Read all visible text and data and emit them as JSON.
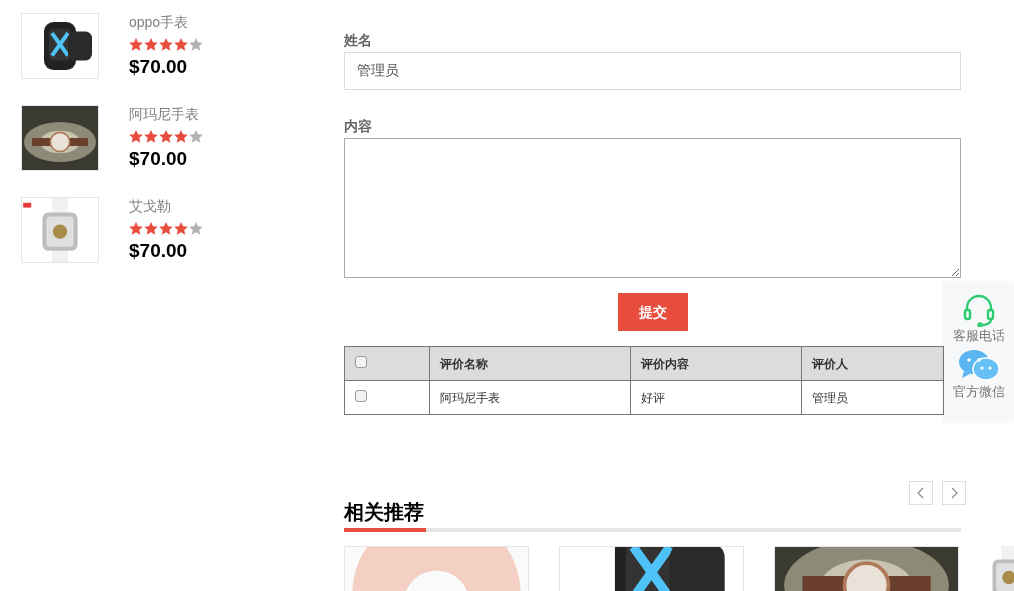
{
  "products": [
    {
      "name": "oppo手表",
      "stars": 4,
      "price": "$70.00"
    },
    {
      "name": "阿玛尼手表",
      "stars": 4,
      "price": "$70.00"
    },
    {
      "name": "艾戈勒",
      "stars": 4,
      "price": "$70.00"
    }
  ],
  "form": {
    "name_label": "姓名",
    "name_value": "管理员",
    "content_label": "内容",
    "submit": "提交"
  },
  "table": {
    "columns": [
      "评价名称",
      "评价内容",
      "评价人"
    ],
    "header_checked": false,
    "rows": [
      {
        "checked": false,
        "cells": [
          "阿玛尼手表",
          "好评",
          "管理员"
        ]
      }
    ]
  },
  "side_widget": [
    {
      "kind": "headset",
      "label": "客服电话"
    },
    {
      "kind": "chat",
      "label": "官方微信"
    }
  ],
  "related": {
    "title": "相关推荐"
  }
}
